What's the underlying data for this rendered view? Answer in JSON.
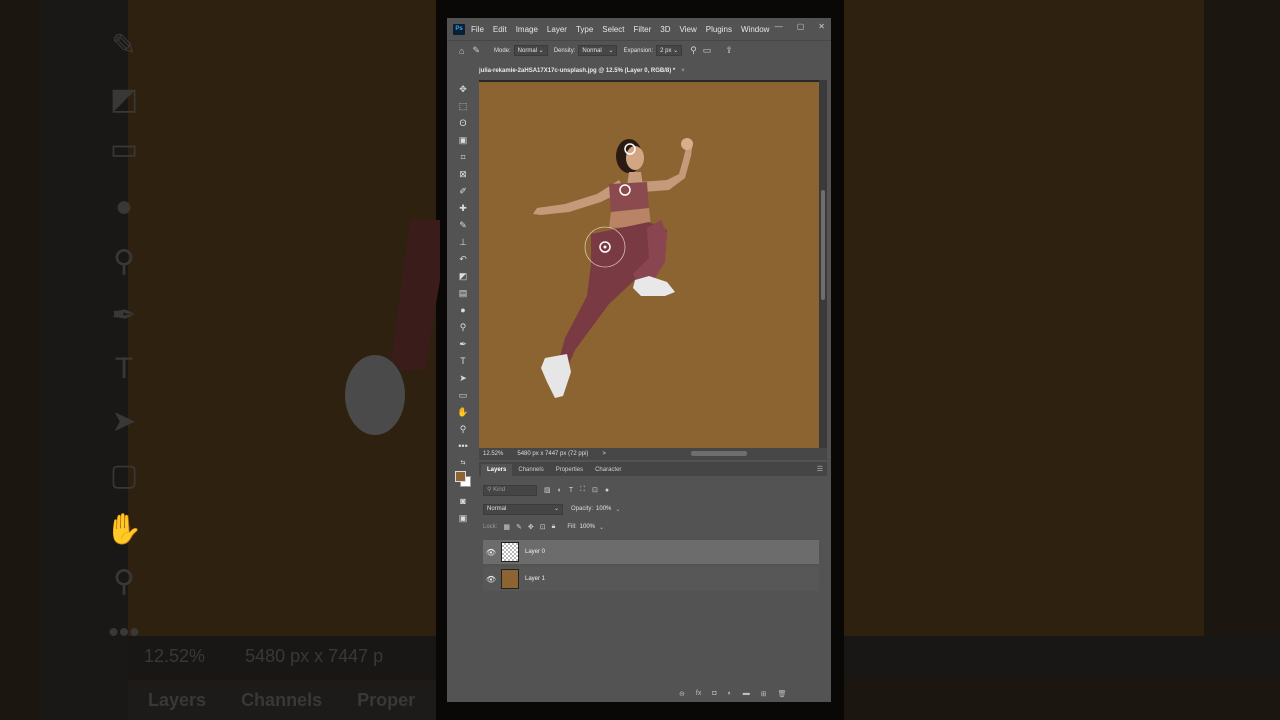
{
  "app": {
    "logo": "Ps",
    "menu": [
      "File",
      "Edit",
      "Image",
      "Layer",
      "Type",
      "Select",
      "Filter",
      "3D",
      "View",
      "Plugins",
      "Window"
    ]
  },
  "options": {
    "mode_label": "Mode:",
    "mode_value": "Normal",
    "density_label": "Density:",
    "density_value": "Normal",
    "expansion_label": "Expansion:",
    "expansion_value": "2 px"
  },
  "document": {
    "tab_title": "julia-rekamie-2aHSA17X17c-unsplash.jpg @ 12.5% (Layer 0, RGB/8) *",
    "close": "×",
    "canvas_color": "#8c6431"
  },
  "status": {
    "zoom": "12.52%",
    "dimensions": "5480 px x 7447 px (72 ppi)",
    "arrow": ">"
  },
  "panel": {
    "tabs": [
      "Layers",
      "Channels",
      "Properties",
      "Character"
    ],
    "kind_placeholder": "Kind",
    "blend_mode": "Normal",
    "opacity_label": "Opacity:",
    "opacity_value": "100%",
    "lock_label": "Lock:",
    "fill_label": "Fill:",
    "fill_value": "100%",
    "layers": [
      {
        "name": "Layer 0",
        "selected": true,
        "thumb": "transparent"
      },
      {
        "name": "Layer 1",
        "selected": false,
        "thumb": "brown"
      }
    ]
  },
  "colors": {
    "foreground": "#8b6535",
    "background": "#ffffff"
  },
  "background_blur": {
    "zoom": "12.52%",
    "dimensions": "5480 px x 7447 p",
    "tabs": [
      "Layers",
      "Channels",
      "Proper"
    ]
  }
}
